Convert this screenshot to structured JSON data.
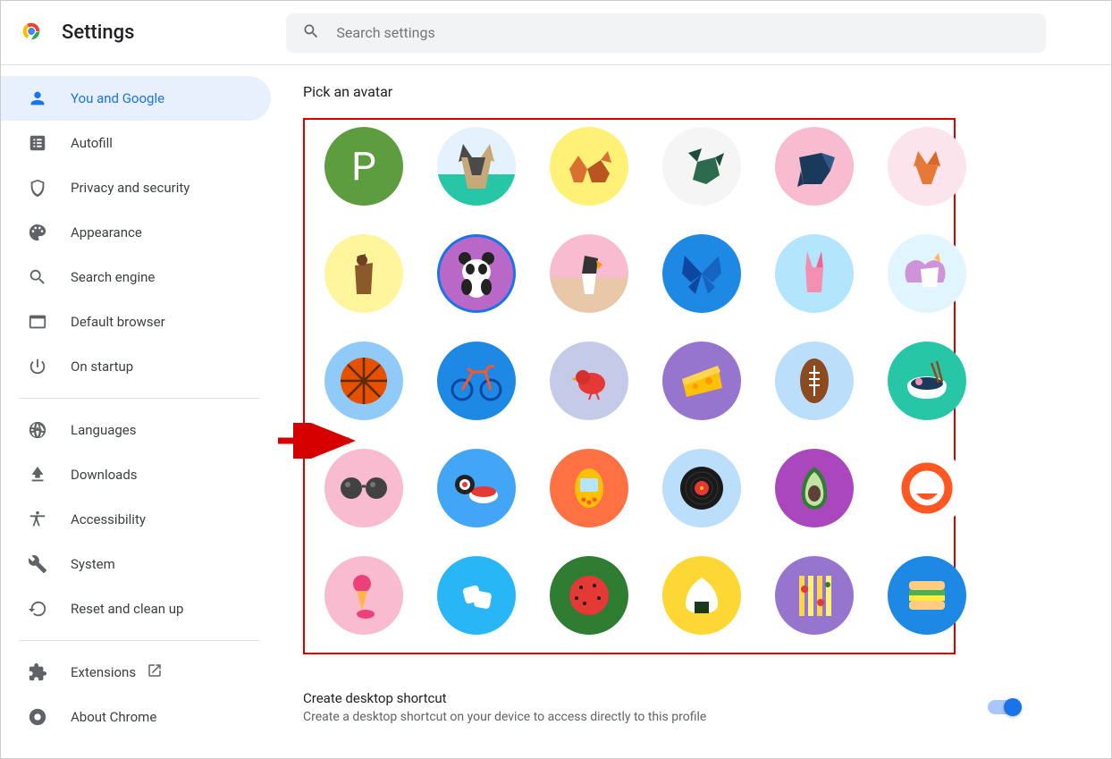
{
  "header": {
    "title": "Settings",
    "search_placeholder": "Search settings"
  },
  "sidebar": {
    "items": [
      {
        "id": "you-and-google",
        "label": "You and Google",
        "active": true
      },
      {
        "id": "autofill",
        "label": "Autofill"
      },
      {
        "id": "privacy",
        "label": "Privacy and security"
      },
      {
        "id": "appearance",
        "label": "Appearance"
      },
      {
        "id": "search-engine",
        "label": "Search engine"
      },
      {
        "id": "default-browser",
        "label": "Default browser"
      },
      {
        "id": "on-startup",
        "label": "On startup"
      }
    ],
    "advanced": [
      {
        "id": "languages",
        "label": "Languages"
      },
      {
        "id": "downloads",
        "label": "Downloads"
      },
      {
        "id": "accessibility",
        "label": "Accessibility"
      },
      {
        "id": "system",
        "label": "System"
      },
      {
        "id": "reset",
        "label": "Reset and clean up"
      }
    ],
    "footer": [
      {
        "id": "extensions",
        "label": "Extensions",
        "external": true
      },
      {
        "id": "about",
        "label": "About Chrome"
      }
    ]
  },
  "main": {
    "avatar_section_title": "Pick an avatar",
    "avatars": [
      {
        "id": "letter-p",
        "bg": "#5d9c3f",
        "letter": "P"
      },
      {
        "id": "cat",
        "bg": "linear-gradient(#e3f2fd 60%, #26c6a6 60%)"
      },
      {
        "id": "fox",
        "bg": "#fff176"
      },
      {
        "id": "dragon",
        "bg": "#f5f5f5"
      },
      {
        "id": "elephant",
        "bg": "#f8bbd0"
      },
      {
        "id": "fox-pink",
        "bg": "#fce4ec"
      },
      {
        "id": "cat-yellow",
        "bg": "#fff59d"
      },
      {
        "id": "panda",
        "bg": "#ba68c8",
        "selected": true
      },
      {
        "id": "penguin",
        "bg": "linear-gradient(#f8bbd0 55%, #e8c8a8 55%)"
      },
      {
        "id": "butterfly",
        "bg": "#1e88e5"
      },
      {
        "id": "rabbit",
        "bg": "#b3e5fc"
      },
      {
        "id": "unicorn",
        "bg": "#e1f5fe"
      },
      {
        "id": "basketball",
        "bg": "#90caf9"
      },
      {
        "id": "bicycle",
        "bg": "#1e88e5"
      },
      {
        "id": "bird",
        "bg": "#c5cae9"
      },
      {
        "id": "cheese",
        "bg": "#9575cd"
      },
      {
        "id": "football",
        "bg": "#bbdefb"
      },
      {
        "id": "ramen",
        "bg": "#26c6a6"
      },
      {
        "id": "sunglasses",
        "bg": "#f8bbd0"
      },
      {
        "id": "sushi",
        "bg": "#42a5f5"
      },
      {
        "id": "tamagotchi",
        "bg": "#ff7043"
      },
      {
        "id": "vinyl",
        "bg": "#bbdefb"
      },
      {
        "id": "avocado",
        "bg": "#ab47bc"
      },
      {
        "id": "smile-ring",
        "bg": "#ffffff"
      },
      {
        "id": "icecream",
        "bg": "#f8bbd0"
      },
      {
        "id": "marshmallow",
        "bg": "#29b6f6"
      },
      {
        "id": "watermelon",
        "bg": "#2e7d32"
      },
      {
        "id": "onigiri",
        "bg": "#fdd835"
      },
      {
        "id": "pizza",
        "bg": "#9575cd"
      },
      {
        "id": "sandwich",
        "bg": "#1e88e5"
      }
    ],
    "shortcut_title": "Create desktop shortcut",
    "shortcut_desc": "Create a desktop shortcut on your device to access directly to this profile",
    "shortcut_enabled": true
  }
}
